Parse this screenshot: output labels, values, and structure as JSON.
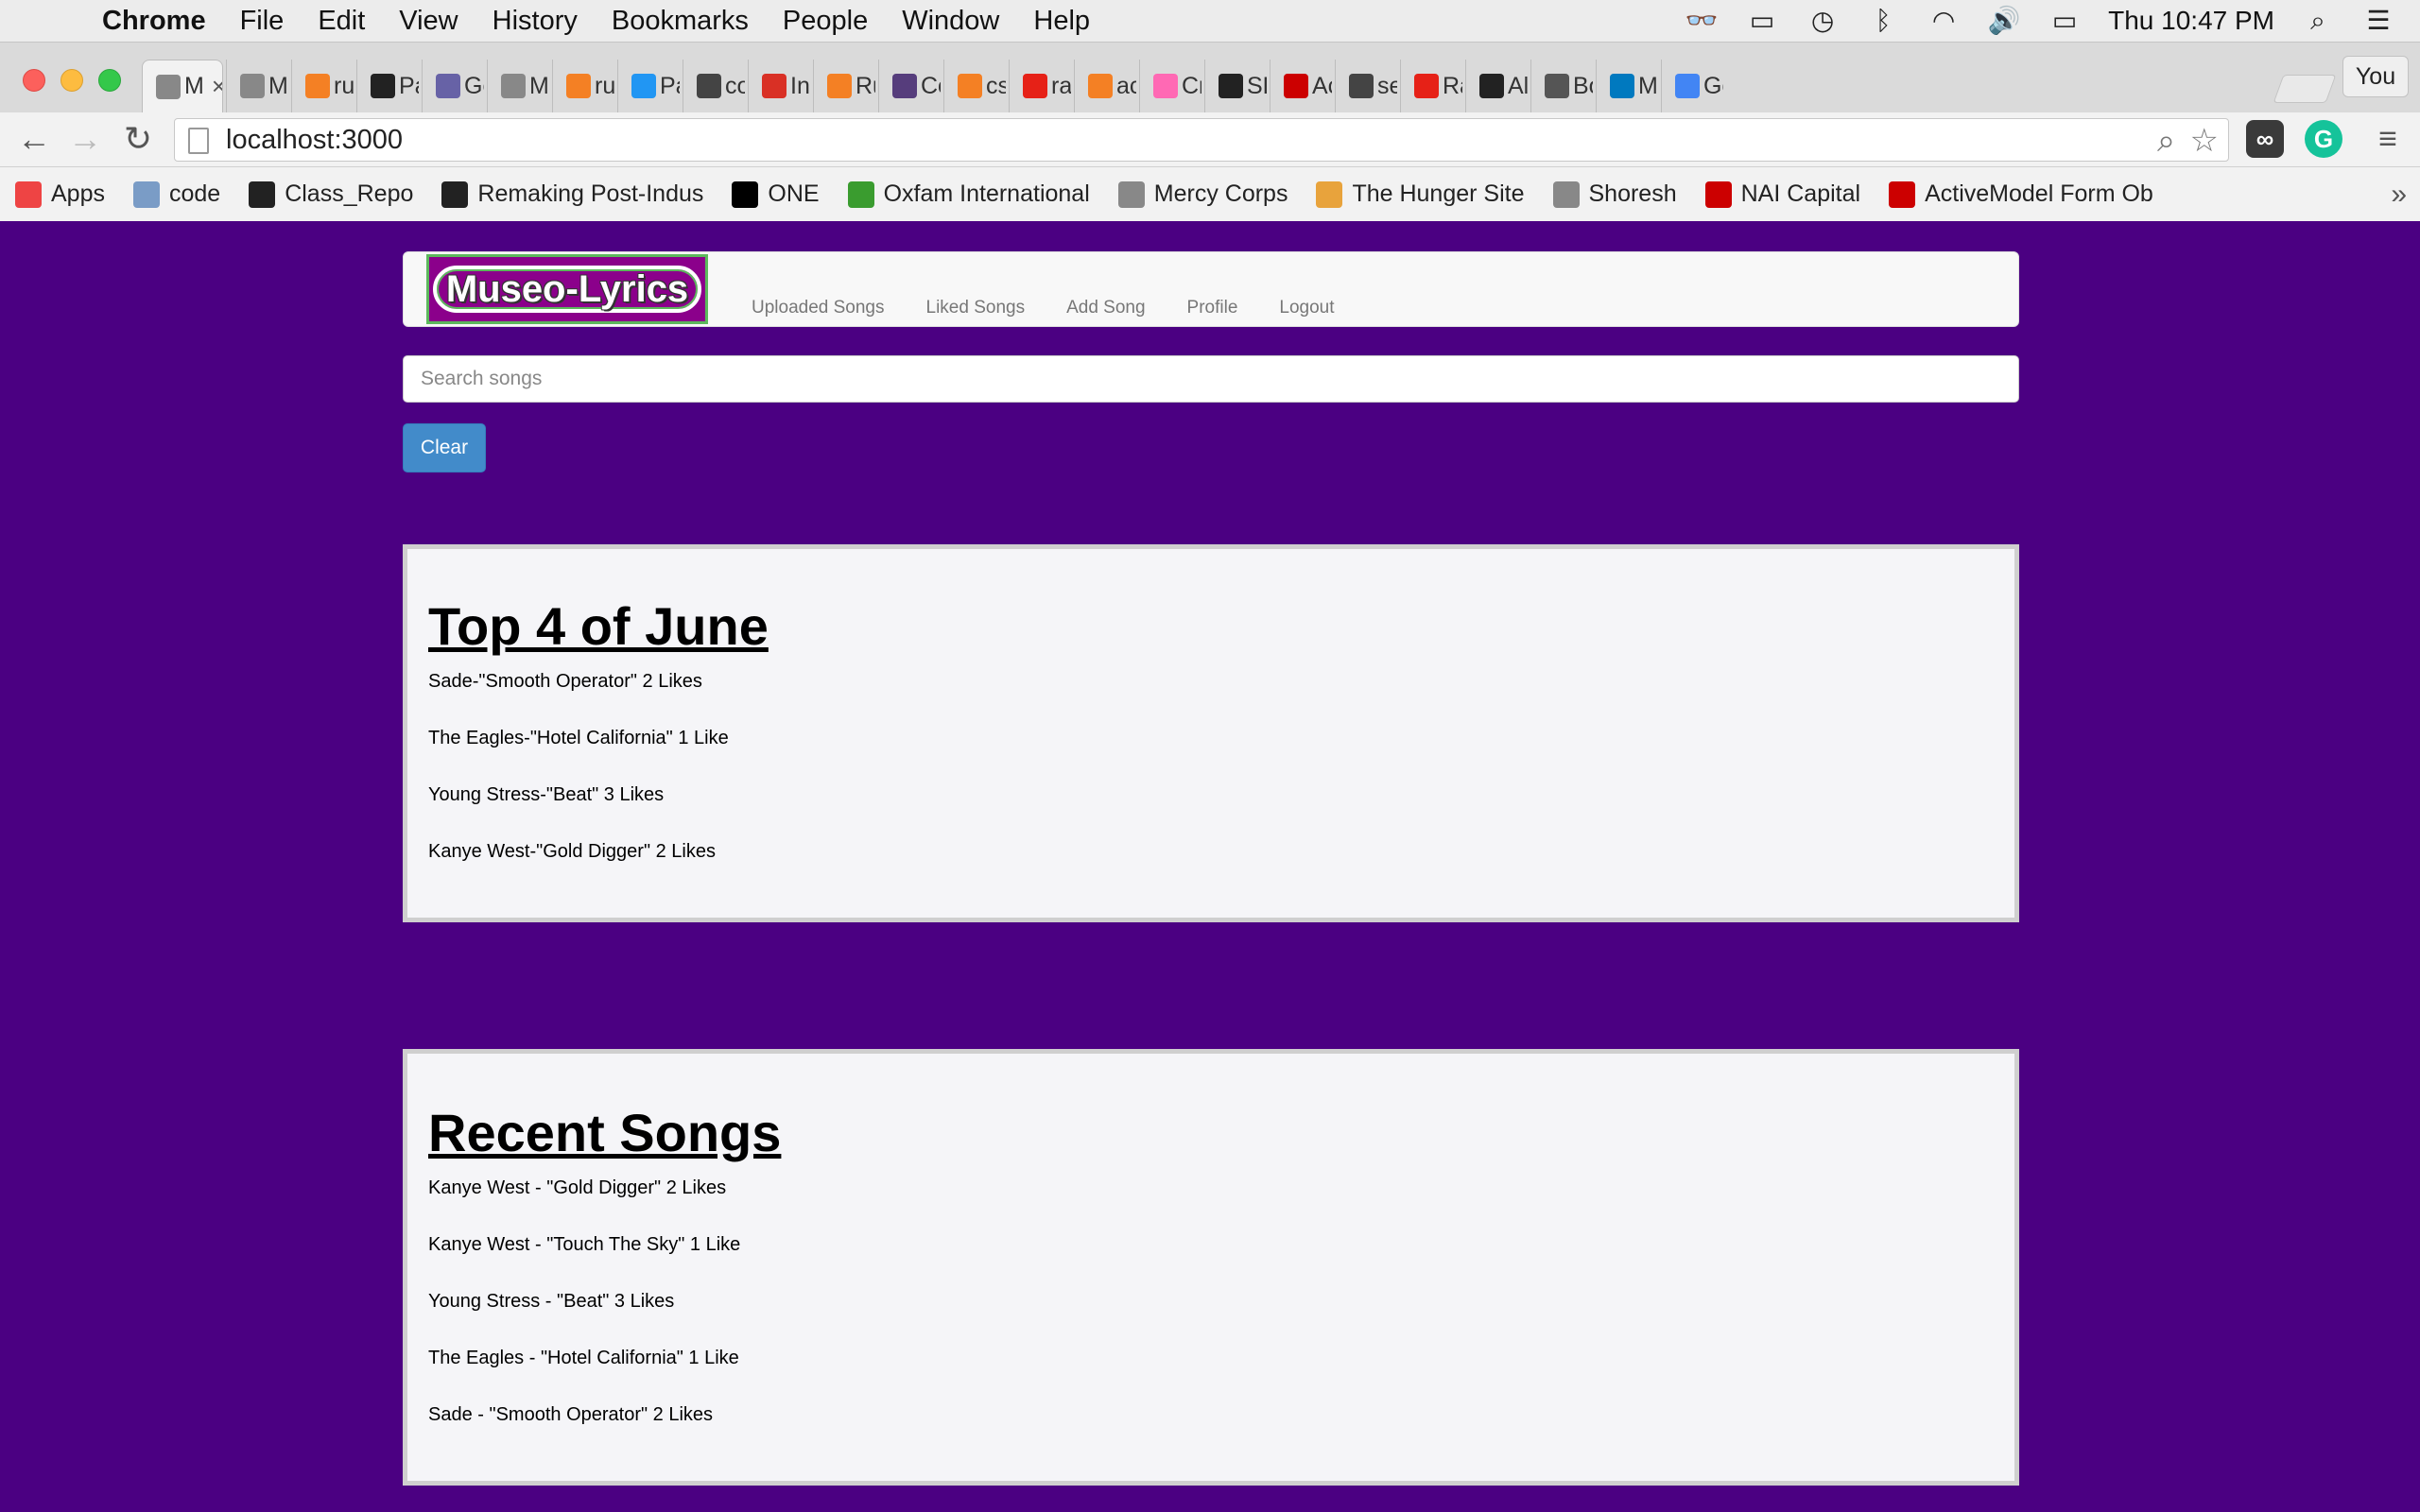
{
  "menubar": {
    "app": "Chrome",
    "items": [
      "File",
      "Edit",
      "View",
      "History",
      "Bookmarks",
      "People",
      "Window",
      "Help"
    ],
    "clock": "Thu 10:47 PM"
  },
  "tabs": [
    {
      "label": "M",
      "active": true,
      "icon": "page-icon",
      "color": "#888"
    },
    {
      "label": "Mu",
      "icon": "page-icon",
      "color": "#888"
    },
    {
      "label": "rul",
      "icon": "stackoverflow-icon",
      "color": "#f48024"
    },
    {
      "label": "Pa",
      "icon": "github-icon",
      "color": "#222"
    },
    {
      "label": "Ge",
      "icon": "heroku-icon",
      "color": "#6762a6"
    },
    {
      "label": "Mu",
      "icon": "page-icon",
      "color": "#888"
    },
    {
      "label": "rul",
      "icon": "stackoverflow-icon",
      "color": "#f48024"
    },
    {
      "label": "Pa",
      "icon": "docs-icon",
      "color": "#2196f3"
    },
    {
      "label": "co",
      "icon": "dock-icon",
      "color": "#444"
    },
    {
      "label": "Inl",
      "icon": "gmail-icon",
      "color": "#d93025"
    },
    {
      "label": "Ru",
      "icon": "stackoverflow-icon",
      "color": "#f48024"
    },
    {
      "label": "Co",
      "icon": "bootstrap-icon",
      "color": "#563d7c"
    },
    {
      "label": "cs",
      "icon": "stackoverflow-icon",
      "color": "#f48024"
    },
    {
      "label": "ra",
      "icon": "youtube-icon",
      "color": "#e62117"
    },
    {
      "label": "ac",
      "icon": "stackoverflow-icon",
      "color": "#f48024"
    },
    {
      "label": "Cr",
      "icon": "heart-icon",
      "color": "#ff69b4"
    },
    {
      "label": "SE",
      "icon": "github-icon",
      "color": "#222"
    },
    {
      "label": "Ac",
      "icon": "ruby-icon",
      "color": "#cc0000"
    },
    {
      "label": "se",
      "icon": "dock-icon",
      "color": "#444"
    },
    {
      "label": "Ra",
      "icon": "youtube-icon",
      "color": "#e62117"
    },
    {
      "label": "Al",
      "icon": "github-icon",
      "color": "#222"
    },
    {
      "label": "Bo",
      "icon": "settings-icon",
      "color": "#555"
    },
    {
      "label": "Mu",
      "icon": "trello-icon",
      "color": "#0079bf"
    },
    {
      "label": "Go",
      "icon": "google-icon",
      "color": "#4285f4"
    }
  ],
  "profile_button": "You",
  "address_bar": {
    "url": "localhost:3000"
  },
  "bookmarks": [
    {
      "label": "Apps",
      "icon": "apps-grid-icon",
      "color": "#e44"
    },
    {
      "label": "code",
      "icon": "folder-icon",
      "color": "#7a9cc6"
    },
    {
      "label": "Class_Repo",
      "icon": "github-icon",
      "color": "#222"
    },
    {
      "label": "Remaking Post-Indus",
      "icon": "amazon-icon",
      "color": "#222"
    },
    {
      "label": "ONE",
      "icon": "one-icon",
      "color": "#000"
    },
    {
      "label": "Oxfam International",
      "icon": "oxfam-icon",
      "color": "#3a9c2f"
    },
    {
      "label": "Mercy Corps",
      "icon": "page-icon",
      "color": "#888"
    },
    {
      "label": "The Hunger Site",
      "icon": "hunger-site-icon",
      "color": "#e8a33c"
    },
    {
      "label": "Shoresh",
      "icon": "page-icon",
      "color": "#888"
    },
    {
      "label": "NAI Capital",
      "icon": "nai-icon",
      "color": "#c00"
    },
    {
      "label": "ActiveModel Form Ob",
      "icon": "rails-icon",
      "color": "#c00"
    }
  ],
  "site": {
    "brand": "Museo-Lyrics",
    "nav": [
      "Uploaded Songs",
      "Liked Songs",
      "Add Song",
      "Profile",
      "Logout"
    ],
    "search_placeholder": "Search songs",
    "clear_label": "Clear",
    "top": {
      "title": "Top 4 of June",
      "songs": [
        "Sade-\"Smooth Operator\" 2 Likes",
        "The Eagles-\"Hotel California\" 1 Like",
        "Young Stress-\"Beat\" 3 Likes",
        "Kanye West-\"Gold Digger\" 2 Likes"
      ]
    },
    "recent": {
      "title": "Recent Songs",
      "songs": [
        "Kanye West - \"Gold Digger\" 2 Likes",
        "Kanye West - \"Touch The Sky\" 1 Like",
        "Young Stress - \"Beat\" 3 Likes",
        "The Eagles - \"Hotel California\" 1 Like",
        "Sade - \"Smooth Operator\" 2 Likes"
      ]
    }
  },
  "colors": {
    "page_background": "#4b0082",
    "brand_background": "#8b008b",
    "brand_border": "#5cb85c",
    "clear_button": "#428bca"
  }
}
